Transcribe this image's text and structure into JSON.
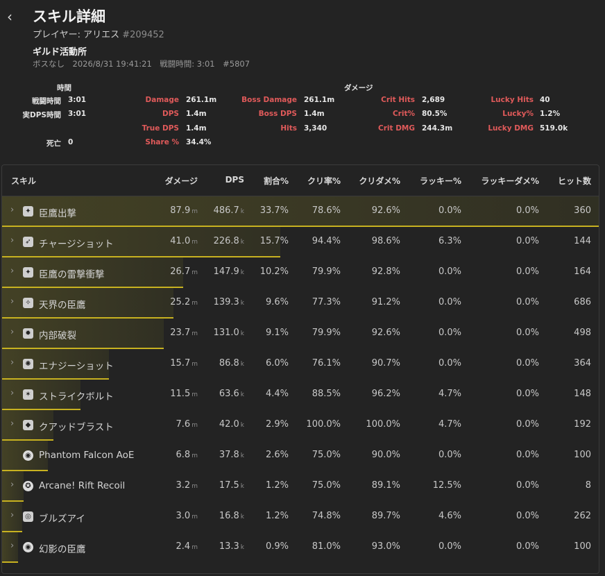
{
  "header": {
    "title": "スキル詳細",
    "player_label": "プレイヤー: アリエス",
    "player_id": "#209452",
    "guild": "ギルド活動所",
    "meta": "ボスなし　2026/8/31 19:41:21　戦闘時間: 3:01　#5807"
  },
  "stats": {
    "time_header": "時間",
    "damage_header": "ダメージ",
    "battle_time_label": "戦闘時間",
    "battle_time": "3:01",
    "real_dps_time_label": "実DPS時間",
    "real_dps_time": "3:01",
    "deaths_label": "死亡",
    "deaths": "0",
    "damage_label": "Damage",
    "damage": "261.1m",
    "dps_label": "DPS",
    "dps": "1.4m",
    "true_dps_label": "True DPS",
    "true_dps": "1.4m",
    "share_label": "Share %",
    "share": "34.4%",
    "boss_damage_label": "Boss Damage",
    "boss_damage": "261.1m",
    "boss_dps_label": "Boss DPS",
    "boss_dps": "1.4m",
    "hits_label": "Hits",
    "hits": "3,340",
    "crit_hits_label": "Crit Hits",
    "crit_hits": "2,689",
    "crit_pct_label": "Crit%",
    "crit_pct": "80.5%",
    "crit_dmg_label": "Crit DMG",
    "crit_dmg": "244.3m",
    "lucky_hits_label": "Lucky Hits",
    "lucky_hits": "40",
    "lucky_pct_label": "Lucky%",
    "lucky_pct": "1.2%",
    "lucky_dmg_label": "Lucky DMG",
    "lucky_dmg": "519.0k"
  },
  "table": {
    "columns": [
      "スキル",
      "ダメージ",
      "DPS",
      "割合%",
      "クリ率%",
      "クリダメ%",
      "ラッキー%",
      "ラッキーダメ%",
      "ヒット数"
    ],
    "accent_color": "#c8b220",
    "rows": [
      {
        "name": "臣鷹出撃",
        "icon": "falcon-strike-icon",
        "damage": "87.9",
        "damage_unit": "m",
        "dps": "486.7",
        "dps_unit": "k",
        "share": "33.7%",
        "share_fraction": 1.0,
        "crit": "78.6%",
        "crit_dmg": "92.6%",
        "lucky": "0.0%",
        "lucky_dmg": "0.0%",
        "hits": "360",
        "expandable": true
      },
      {
        "name": "チャージショット",
        "icon": "charge-shot-icon",
        "damage": "41.0",
        "damage_unit": "m",
        "dps": "226.8",
        "dps_unit": "k",
        "share": "15.7%",
        "share_fraction": 0.466,
        "crit": "94.4%",
        "crit_dmg": "98.6%",
        "lucky": "6.3%",
        "lucky_dmg": "0.0%",
        "hits": "144",
        "expandable": true
      },
      {
        "name": "臣鷹の雷撃衝撃",
        "icon": "falcon-thunder-icon",
        "damage": "26.7",
        "damage_unit": "m",
        "dps": "147.9",
        "dps_unit": "k",
        "share": "10.2%",
        "share_fraction": 0.303,
        "crit": "79.9%",
        "crit_dmg": "92.8%",
        "lucky": "0.0%",
        "lucky_dmg": "0.0%",
        "hits": "164",
        "expandable": true
      },
      {
        "name": "天界の臣鷹",
        "icon": "celestial-falcon-icon",
        "damage": "25.2",
        "damage_unit": "m",
        "dps": "139.3",
        "dps_unit": "k",
        "share": "9.6%",
        "share_fraction": 0.287,
        "crit": "77.3%",
        "crit_dmg": "91.2%",
        "lucky": "0.0%",
        "lucky_dmg": "0.0%",
        "hits": "686",
        "expandable": true
      },
      {
        "name": "内部破裂",
        "icon": "internal-burst-icon",
        "damage": "23.7",
        "damage_unit": "m",
        "dps": "131.0",
        "dps_unit": "k",
        "share": "9.1%",
        "share_fraction": 0.271,
        "crit": "79.9%",
        "crit_dmg": "92.6%",
        "lucky": "0.0%",
        "lucky_dmg": "0.0%",
        "hits": "498",
        "expandable": true
      },
      {
        "name": "エナジーショット",
        "icon": "energy-shot-icon",
        "damage": "15.7",
        "damage_unit": "m",
        "dps": "86.8",
        "dps_unit": "k",
        "share": "6.0%",
        "share_fraction": 0.179,
        "crit": "76.1%",
        "crit_dmg": "90.7%",
        "lucky": "0.0%",
        "lucky_dmg": "0.0%",
        "hits": "364",
        "expandable": true
      },
      {
        "name": "ストライクボルト",
        "icon": "strike-bolt-icon",
        "damage": "11.5",
        "damage_unit": "m",
        "dps": "63.6",
        "dps_unit": "k",
        "share": "4.4%",
        "share_fraction": 0.131,
        "crit": "88.5%",
        "crit_dmg": "96.2%",
        "lucky": "4.7%",
        "lucky_dmg": "0.0%",
        "hits": "148",
        "expandable": true
      },
      {
        "name": "クアッドブラスト",
        "icon": "quad-blast-icon",
        "damage": "7.6",
        "damage_unit": "m",
        "dps": "42.0",
        "dps_unit": "k",
        "share": "2.9%",
        "share_fraction": 0.086,
        "crit": "100.0%",
        "crit_dmg": "100.0%",
        "lucky": "4.7%",
        "lucky_dmg": "0.0%",
        "hits": "192",
        "expandable": true
      },
      {
        "name": "Phantom Falcon AoE",
        "icon": "phantom-falcon-icon",
        "damage": "6.8",
        "damage_unit": "m",
        "dps": "37.8",
        "dps_unit": "k",
        "share": "2.6%",
        "share_fraction": 0.077,
        "crit": "75.0%",
        "crit_dmg": "90.0%",
        "lucky": "0.0%",
        "lucky_dmg": "0.0%",
        "hits": "100",
        "expandable": false
      },
      {
        "name": "Arcane! Rift Recoil",
        "icon": "rift-recoil-icon",
        "damage": "3.2",
        "damage_unit": "m",
        "dps": "17.5",
        "dps_unit": "k",
        "share": "1.2%",
        "share_fraction": 0.036,
        "crit": "75.0%",
        "crit_dmg": "89.1%",
        "lucky": "12.5%",
        "lucky_dmg": "0.0%",
        "hits": "8",
        "expandable": true
      },
      {
        "name": "ブルズアイ",
        "icon": "bullseye-icon",
        "damage": "3.0",
        "damage_unit": "m",
        "dps": "16.8",
        "dps_unit": "k",
        "share": "1.2%",
        "share_fraction": 0.034,
        "crit": "74.8%",
        "crit_dmg": "89.7%",
        "lucky": "4.6%",
        "lucky_dmg": "0.0%",
        "hits": "262",
        "expandable": true
      },
      {
        "name": "幻影の臣鷹",
        "icon": "phantom-falcon-icon",
        "damage": "2.4",
        "damage_unit": "m",
        "dps": "13.3",
        "dps_unit": "k",
        "share": "0.9%",
        "share_fraction": 0.027,
        "crit": "81.0%",
        "crit_dmg": "93.0%",
        "lucky": "0.0%",
        "lucky_dmg": "0.0%",
        "hits": "100",
        "expandable": true
      }
    ]
  }
}
